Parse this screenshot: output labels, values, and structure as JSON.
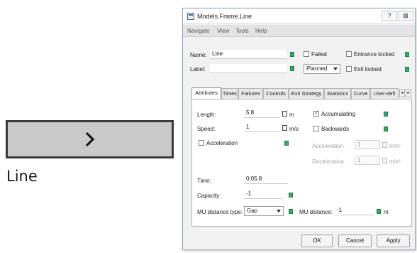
{
  "object": {
    "label": "Line",
    "icon": "chevron-right-icon"
  },
  "dialog": {
    "title": "Models.Frame.Line",
    "help_button": "?",
    "close_button": "⊠",
    "menu": [
      "Navigate",
      "View",
      "Tools",
      "Help"
    ],
    "name_label": "Name:",
    "name_value": "Line",
    "label_label": "Label:",
    "label_value": "",
    "failed_label": "Failed",
    "entrance_locked_label": "Entrance locked",
    "exit_locked_label": "Exit locked",
    "state_value": "Planned",
    "tabs": [
      "Attributes",
      "Times",
      "Failures",
      "Controls",
      "Exit Strategy",
      "Statistics",
      "Curve",
      "User-defi"
    ],
    "active_tab": "Attributes",
    "attributes": {
      "length_label": "Length:",
      "length_value": "5.8",
      "length_unit": "m",
      "speed_label": "Speed:",
      "speed_value": "1",
      "speed_unit": "m/s",
      "acceleration_label": "Acceleration",
      "accumulating_label": "Accumulating",
      "accumulating_checked": "✓",
      "backwards_label": "Backwards",
      "acceleration_field_label": "Acceleration:",
      "acceleration_field_value": "1",
      "acceleration_unit": "m/s²",
      "deceleration_field_label": "Deceleration:",
      "deceleration_field_value": "1",
      "deceleration_unit": "m/s²",
      "time_label": "Time:",
      "time_value": "0:05.8",
      "capacity_label": "Capacity:",
      "capacity_value": "-1",
      "mu_distance_type_label": "MU distance type:",
      "mu_distance_type_value": "Gap",
      "mu_distance_label": "MU distance:",
      "mu_distance_value": "-1",
      "mu_distance_unit": "m"
    },
    "buttons": {
      "ok": "OK",
      "cancel": "Cancel",
      "apply": "Apply"
    }
  },
  "colors": {
    "inherit_icon": "#39a86b",
    "object_fill": "#c9c9c9",
    "object_border": "#3a3a3a"
  }
}
